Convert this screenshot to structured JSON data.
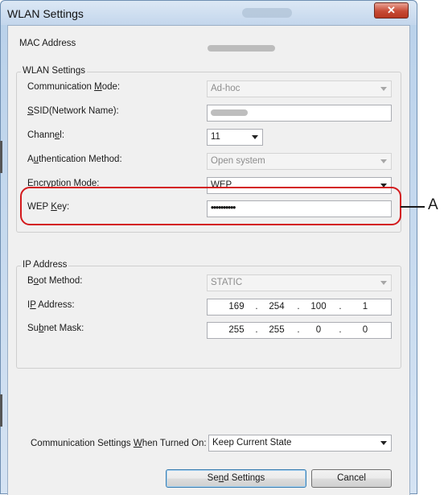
{
  "window": {
    "title": "WLAN Settings",
    "close_glyph": "✕"
  },
  "mac": {
    "label": "MAC Address"
  },
  "wlan_group": {
    "title": "WLAN Settings",
    "comm_mode": {
      "label_pre": "Communication ",
      "label_key": "M",
      "label_post": "ode:",
      "value": "Ad-hoc"
    },
    "ssid": {
      "label_pre": "",
      "label_key": "S",
      "label_post": "SID(Network Name):"
    },
    "channel": {
      "label_pre": "Chann",
      "label_key": "e",
      "label_post": "l:",
      "value": "11"
    },
    "auth": {
      "label_pre": "A",
      "label_key": "u",
      "label_post": "thentication Method:",
      "value": "Open system"
    },
    "encryption": {
      "label_pre": "Encr",
      "label_key": "y",
      "label_post": "ption Mode:",
      "value": "WEP"
    },
    "wep_key": {
      "label_pre": "WEP ",
      "label_key": "K",
      "label_post": "ey:",
      "value": "••••••••••"
    }
  },
  "ip_group": {
    "title": "IP Address",
    "boot": {
      "label_pre": "B",
      "label_key": "o",
      "label_post": "ot Method:",
      "value": "STATIC"
    },
    "ip": {
      "label_pre": "I",
      "label_key": "P",
      "label_post": " Address:",
      "octets": [
        "169",
        "254",
        "100",
        "1"
      ]
    },
    "subnet": {
      "label_pre": "Su",
      "label_key": "b",
      "label_post": "net Mask:",
      "octets": [
        "255",
        "255",
        "0",
        "0"
      ]
    }
  },
  "comm_on": {
    "label_pre": "Communication Settings ",
    "label_key": "W",
    "label_post": "hen Turned On:",
    "value": "Keep Current State"
  },
  "buttons": {
    "send_pre": "Se",
    "send_key": "n",
    "send_post": "d Settings",
    "cancel": "Cancel"
  },
  "callout": {
    "label": "A"
  },
  "colors": {
    "callout": "#d3191c",
    "titlebar": "#c3d6ec",
    "close": "#c74b35"
  },
  "icons": {
    "close": "close-icon",
    "dropdown": "chevron-down-icon"
  }
}
